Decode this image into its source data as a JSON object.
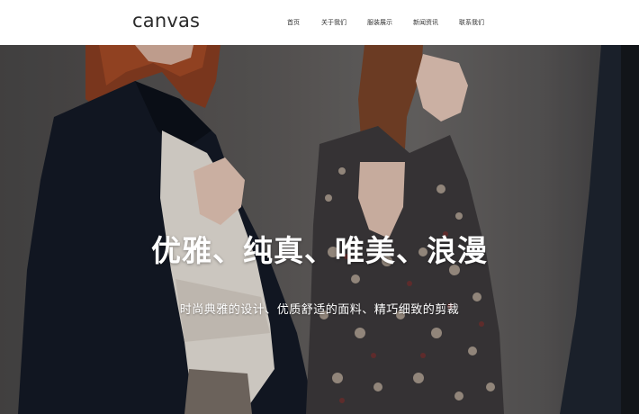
{
  "header": {
    "logo": "canvas",
    "nav": [
      {
        "label": "首页"
      },
      {
        "label": "关于我们"
      },
      {
        "label": "服装展示"
      },
      {
        "label": "新闻资讯"
      },
      {
        "label": "联系我们"
      }
    ]
  },
  "hero": {
    "title": "优雅、纯真、唯美、浪漫",
    "subtitle": "时尚典雅的设计、优质舒适的面料、精巧细致的剪裁",
    "image_icon": "fashion-models-photo"
  }
}
